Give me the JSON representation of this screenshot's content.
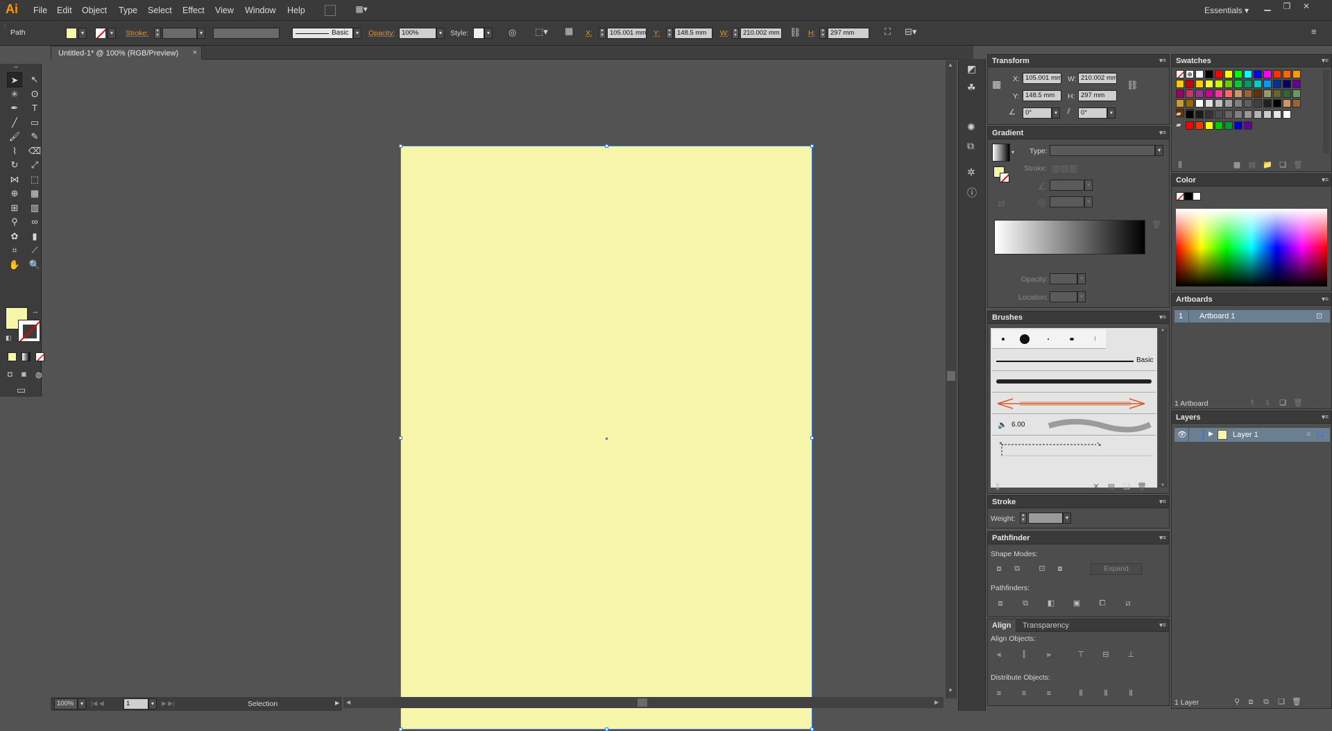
{
  "app": {
    "logo": "Ai",
    "menus": [
      "File",
      "Edit",
      "Object",
      "Type",
      "Select",
      "Effect",
      "View",
      "Window",
      "Help"
    ],
    "workspace": "Essentials"
  },
  "control_bar": {
    "selection_type": "Path",
    "stroke_label": "Stroke:",
    "brush_name": "Basic",
    "opacity_label": "Opacity:",
    "opacity_value": "100%",
    "style_label": "Style:",
    "x_label": "X:",
    "x_value": "105.001 mm",
    "y_label": "Y:",
    "y_value": "148.5 mm",
    "w_label": "W:",
    "w_value": "210.002 mm",
    "h_label": "H:",
    "h_value": "297 mm",
    "fill_color": "#f7f5a9"
  },
  "document": {
    "tab_title": "Untitled-1* @ 100% (RGB/Preview)",
    "artboard_color": "#f7f5a9",
    "selection_color": "#3a7bd5"
  },
  "status": {
    "zoom": "100%",
    "artboard_num": "1",
    "tool_status": "Selection"
  },
  "toolbox": {
    "fill_color": "#f7f5a9",
    "tools": [
      {
        "name": "selection-tool",
        "glyph": "➤"
      },
      {
        "name": "direct-selection-tool",
        "glyph": "↖"
      },
      {
        "name": "magic-wand-tool",
        "glyph": "✳"
      },
      {
        "name": "lasso-tool",
        "glyph": "ʘ"
      },
      {
        "name": "pen-tool",
        "glyph": "✒"
      },
      {
        "name": "type-tool",
        "glyph": "T"
      },
      {
        "name": "line-tool",
        "glyph": "╱"
      },
      {
        "name": "rectangle-tool",
        "glyph": "▭"
      },
      {
        "name": "paintbrush-tool",
        "glyph": "🖌"
      },
      {
        "name": "pencil-tool",
        "glyph": "✎"
      },
      {
        "name": "blob-brush-tool",
        "glyph": "⌇"
      },
      {
        "name": "eraser-tool",
        "glyph": "⌫"
      },
      {
        "name": "rotate-tool",
        "glyph": "↻"
      },
      {
        "name": "scale-tool",
        "glyph": "⤢"
      },
      {
        "name": "width-tool",
        "glyph": "⋈"
      },
      {
        "name": "free-transform-tool",
        "glyph": "⬚"
      },
      {
        "name": "shape-builder-tool",
        "glyph": "⊕"
      },
      {
        "name": "perspective-grid-tool",
        "glyph": "▦"
      },
      {
        "name": "mesh-tool",
        "glyph": "⊞"
      },
      {
        "name": "gradient-tool",
        "glyph": "▥"
      },
      {
        "name": "eyedropper-tool",
        "glyph": "⚲"
      },
      {
        "name": "blend-tool",
        "glyph": "∞"
      },
      {
        "name": "symbol-sprayer-tool",
        "glyph": "✿"
      },
      {
        "name": "column-graph-tool",
        "glyph": "▮"
      },
      {
        "name": "artboard-tool",
        "glyph": "⌗"
      },
      {
        "name": "slice-tool",
        "glyph": "⟋"
      },
      {
        "name": "hand-tool",
        "glyph": "✋"
      },
      {
        "name": "zoom-tool",
        "glyph": "🔍"
      }
    ]
  },
  "transform": {
    "title": "Transform",
    "x_label": "X:",
    "x_value": "105.001 mm",
    "y_label": "Y:",
    "y_value": "148.5 mm",
    "w_label": "W:",
    "w_value": "210.002 mm",
    "h_label": "H:",
    "h_value": "297 mm",
    "rotate_value": "0°",
    "shear_value": "0°"
  },
  "gradient": {
    "title": "Gradient",
    "type_label": "Type:",
    "stroke_label": "Stroke:",
    "opacity_label": "Opacity:",
    "location_label": "Location:"
  },
  "brushes": {
    "title": "Brushes",
    "basic_label": "Basic",
    "size_label": "6.00"
  },
  "stroke": {
    "title": "Stroke",
    "weight_label": "Weight:"
  },
  "pathfinder": {
    "title": "Pathfinder",
    "shape_modes_label": "Shape Modes:",
    "expand_label": "Expand",
    "pathfinders_label": "Pathfinders:"
  },
  "align": {
    "title": "Align",
    "tab2": "Transparency",
    "align_objects_label": "Align Objects:",
    "distribute_label": "Distribute Objects:"
  },
  "swatches": {
    "title": "Swatches",
    "colors": [
      "#ffffff",
      "#000000",
      "#ff0000",
      "#ffff00",
      "#00ff00",
      "#00ffff",
      "#0000ff",
      "#ff00ff",
      "#ff3300",
      "#ff6600",
      "#ff9900",
      "#ffcc00",
      "#cc0000",
      "#ffcc00",
      "#ffff33",
      "#ccff00",
      "#66cc00",
      "#00cc33",
      "#009966",
      "#00cccc",
      "#0099ff",
      "#003399",
      "#000066",
      "#660099",
      "#990066",
      "#cc3366",
      "#993399",
      "#cc0099",
      "#ff3399",
      "#ff6666",
      "#cc9966",
      "#996633",
      "#663300",
      "#999966",
      "#666633",
      "#336633",
      "#669966",
      "#cc9933",
      "#996600",
      "#ffffff",
      "#e0e0e0",
      "#c0c0c0",
      "#a0a0a0",
      "#808080",
      "#606060",
      "#404040",
      "#202020",
      "#000000",
      "#cc9966",
      "#996633",
      "#663300",
      "#333333"
    ],
    "folder_colors": [
      "#000000",
      "#1a1a1a",
      "#333333",
      "#4d4d4d",
      "#666666",
      "#808080",
      "#999999",
      "#b3b3b3",
      "#cccccc",
      "#e6e6e6",
      "#ffffff"
    ],
    "bright_colors": [
      "#ff0000",
      "#ff3300",
      "#ffff00",
      "#00cc00",
      "#009933",
      "#0000cc",
      "#660099"
    ]
  },
  "color": {
    "title": "Color"
  },
  "artboards": {
    "title": "Artboards",
    "items": [
      {
        "num": "1",
        "name": "Artboard 1"
      }
    ],
    "count_label": "1 Artboard"
  },
  "layers": {
    "title": "Layers",
    "items": [
      {
        "name": "Layer 1"
      }
    ],
    "count_label": "1 Layer"
  }
}
